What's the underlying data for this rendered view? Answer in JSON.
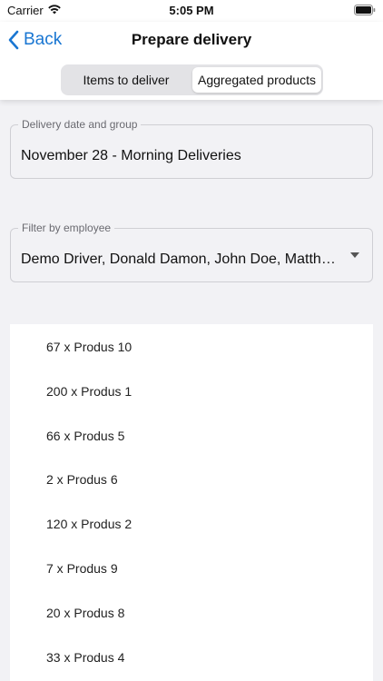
{
  "status": {
    "carrier": "Carrier",
    "time": "5:05 PM"
  },
  "nav": {
    "back_label": "Back",
    "title": "Prepare delivery",
    "tabs": [
      {
        "label": "Items to deliver",
        "selected": false
      },
      {
        "label": "Aggregated products",
        "selected": true
      }
    ]
  },
  "delivery": {
    "label": "Delivery date and group",
    "value": "November 28 - Morning Deliveries"
  },
  "employee_filter": {
    "label": "Filter by employee",
    "value": "Demo Driver, Donald Damon, John Doe, Matthew"
  },
  "products": [
    "67 x Produs 10",
    "200 x Produs 1",
    "66 x Produs 5",
    "2 x Produs 6",
    "120 x Produs 2",
    "7 x Produs 9",
    "20 x Produs 8",
    "33 x Produs 4"
  ],
  "colors": {
    "accent": "#1976d2",
    "background": "#f2f2f5"
  }
}
